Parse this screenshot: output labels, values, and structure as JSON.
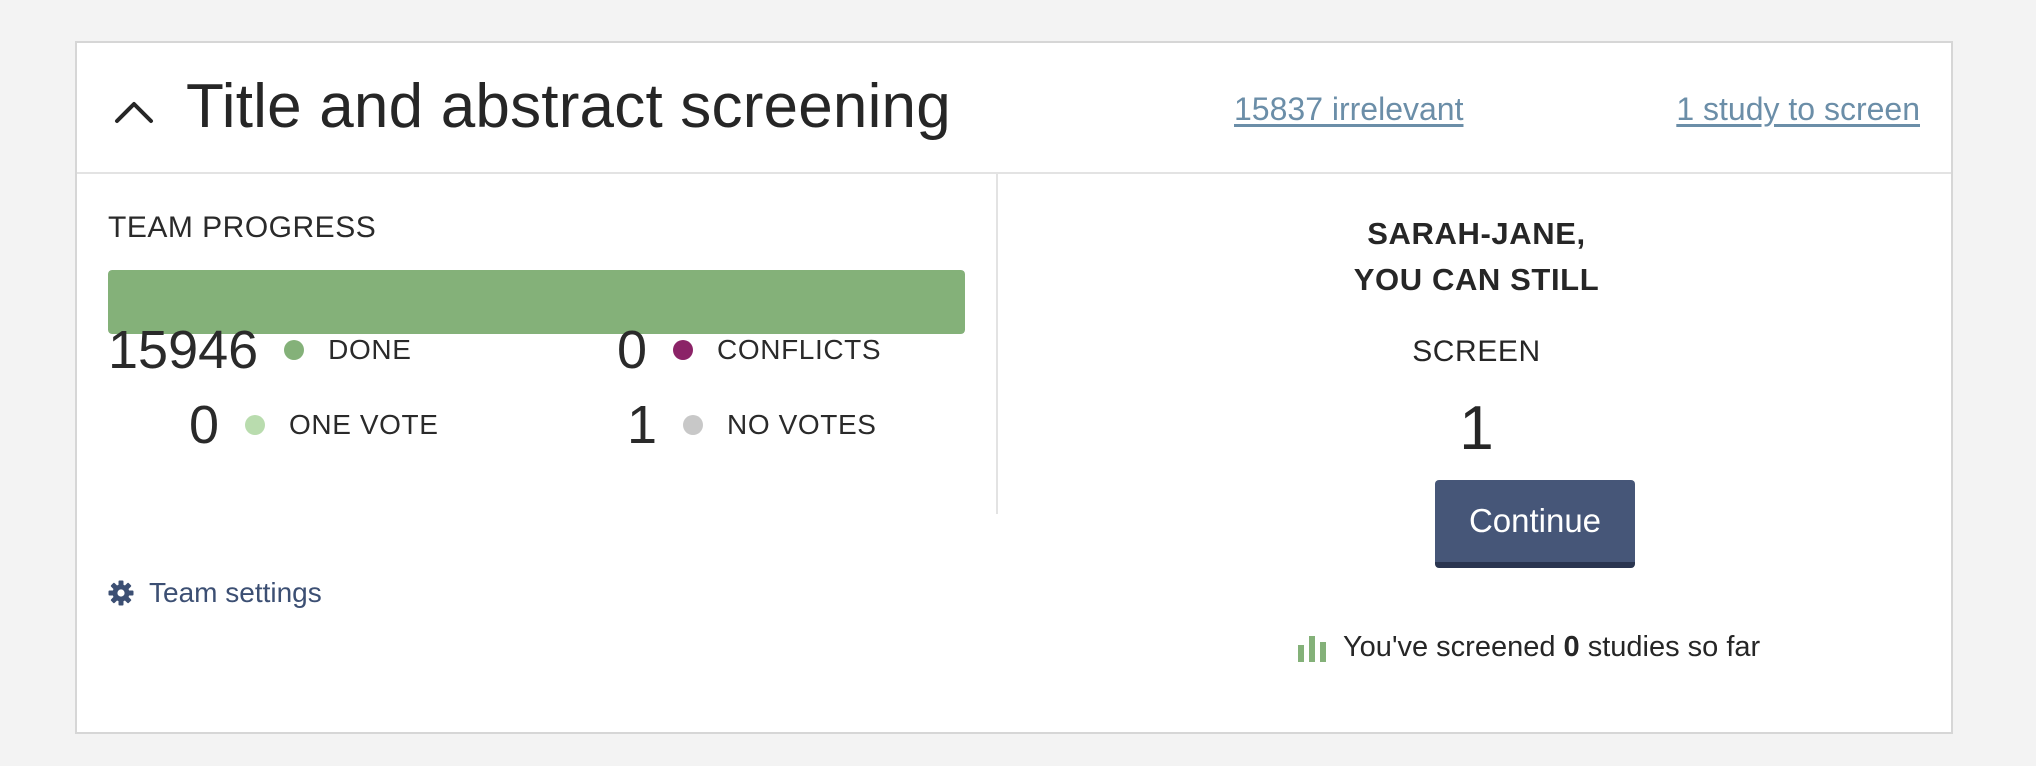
{
  "header": {
    "toggle_icon": "chevron-up-icon",
    "title": "Title and abstract screening",
    "irrelevant_link": "15837 irrelevant",
    "to_screen_link": "1 study to screen"
  },
  "team_progress": {
    "label": "TEAM PROGRESS",
    "progress_percent": 100,
    "stats": {
      "done": {
        "count": "15946",
        "label": "DONE",
        "color": "#84b179"
      },
      "conflicts": {
        "count": "0",
        "label": "CONFLICTS",
        "color": "#8b2367"
      },
      "one_vote": {
        "count": "0",
        "label": "ONE VOTE",
        "color": "#b9dcae"
      },
      "no_votes": {
        "count": "1",
        "label": "NO VOTES",
        "color": "#c8c8c8"
      }
    },
    "team_settings_icon": "gear-icon",
    "team_settings_label": "Team settings"
  },
  "personal": {
    "greeting_line1": "SARAH-JANE,",
    "greeting_line2": "YOU CAN STILL",
    "screen_label": "SCREEN",
    "remaining_count": "1",
    "continue_label": "Continue",
    "stats_icon": "bar-chart-icon",
    "screened_prefix": "You've screened ",
    "screened_count": "0",
    "screened_suffix": " studies so far"
  },
  "colors": {
    "accent": "#465678",
    "link": "#6b8ea8",
    "progress": "#84b179"
  }
}
